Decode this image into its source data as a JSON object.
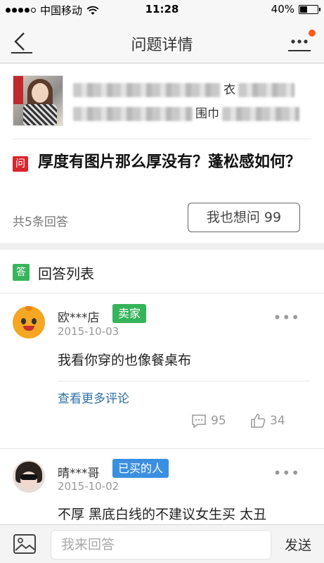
{
  "status_bar": {
    "carrier": "中国移动",
    "time": "11:28",
    "battery_percent": "40%",
    "battery_level": 0.4
  },
  "nav": {
    "title": "问题详情",
    "back_icon": "back-arrow-icon",
    "more_icon": "more-dots-icon",
    "notification_color": "#ff5a1a"
  },
  "question": {
    "product_title_line1": "",
    "product_title_fragment1": "衣",
    "product_title_line2_fragment": "围巾",
    "badge": "问",
    "text": "厚度有图片那么厚没有？蓬松感如何？",
    "answer_count": "共5条回答",
    "ask_button": "我也想问 99"
  },
  "answers_section": {
    "badge": "答",
    "title": "回答列表",
    "items": [
      {
        "user": "欧***店",
        "role": "卖家",
        "date": "2015-10-03",
        "text": "我看你穿的也像餐桌布",
        "more_comments": "查看更多评论",
        "comments": "95",
        "likes": "34"
      },
      {
        "user": "晴***哥",
        "role": "已买的人",
        "date": "2015-10-02",
        "text": "不厚 黑底白线的不建议女生买 太丑"
      }
    ]
  },
  "input_bar": {
    "placeholder": "我来回答",
    "send": "发送",
    "image_icon": "image-icon"
  },
  "colors": {
    "question_badge": "#d8262c",
    "answer_badge": "#38b55b",
    "seller_tag": "#35b45a",
    "buyer_tag": "#3b8fe0",
    "link": "#2e6fa8"
  }
}
